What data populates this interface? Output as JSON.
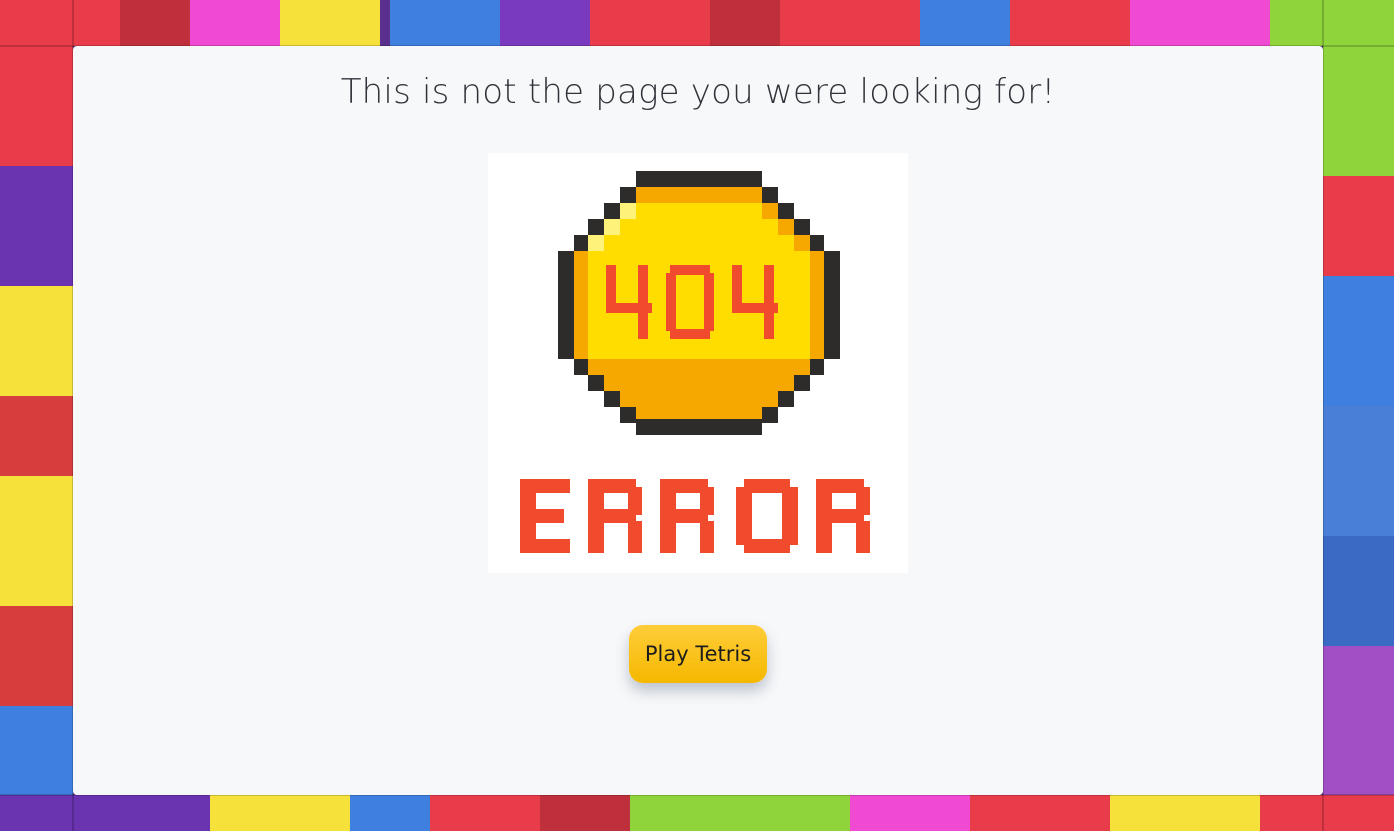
{
  "page": {
    "heading": "This is not the page you were looking for!"
  },
  "error_image": {
    "code_text": "404",
    "label_text": "ERROR",
    "coin_color": "#ffdd00",
    "coin_shade_color": "#f6a800",
    "outline_color": "#2e2b2b",
    "text_color": "#f04b2c"
  },
  "actions": {
    "play_label": "Play Tetris",
    "button_color": "#fbc21a"
  },
  "background": {
    "description_icon": "tetris-blocks-background",
    "colors": [
      "#e83c4a",
      "#f5e13a",
      "#8a3fd1",
      "#3f7fe0",
      "#8ed43a",
      "#f04ad3"
    ]
  }
}
